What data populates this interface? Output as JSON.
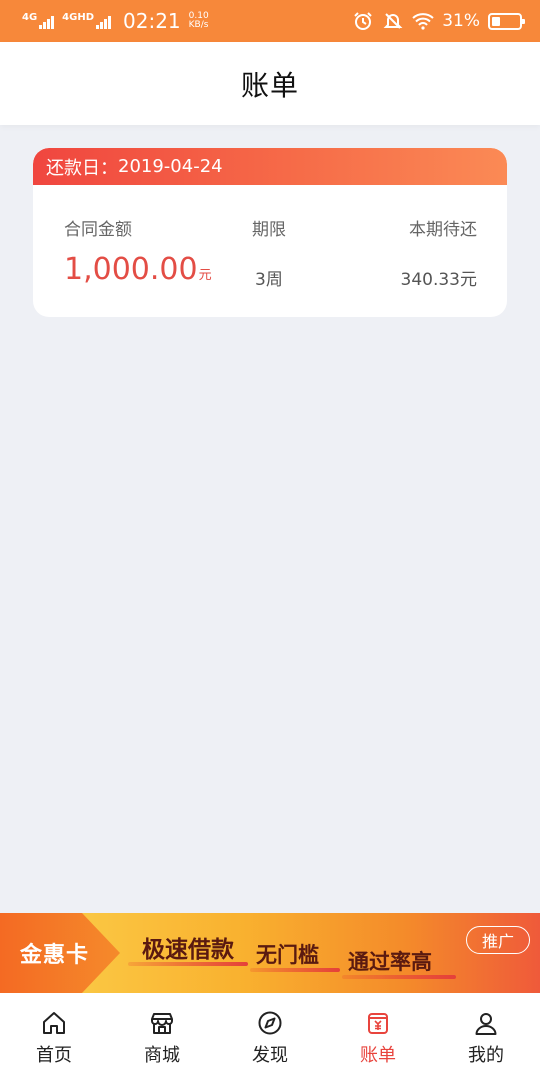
{
  "status_bar": {
    "net1": "4G",
    "net2": "4GHD",
    "time": "02:21",
    "speed_value": "0.10",
    "speed_unit": "KB/s",
    "battery_pct": "31%",
    "battery_level": 0.31,
    "icons": [
      "alarm-icon",
      "mute-bell-icon",
      "wifi-icon",
      "battery-icon"
    ]
  },
  "header": {
    "title": "账单"
  },
  "bill": {
    "due_label": "还款日：",
    "due_date": "2019-04-24",
    "contract_label": "合同金额",
    "contract_amount": "1,000.00",
    "contract_unit": "元",
    "term_label": "期限",
    "term_value": "3周",
    "current_label": "本期待还",
    "current_value": "340.33元"
  },
  "promo": {
    "brand": "金惠卡",
    "slogan1": "极速借款",
    "slogan2": "无门槛",
    "slogan3": "通过率高",
    "ad_label": "推广"
  },
  "nav": {
    "items": [
      {
        "label": "首页",
        "icon": "home-icon",
        "active": false
      },
      {
        "label": "商城",
        "icon": "shop-icon",
        "active": false
      },
      {
        "label": "发现",
        "icon": "compass-icon",
        "active": false
      },
      {
        "label": "账单",
        "icon": "bill-icon",
        "active": true
      },
      {
        "label": "我的",
        "icon": "user-icon",
        "active": false
      }
    ]
  },
  "colors": {
    "status_bar": "#f7883a",
    "accent_red": "#e8443d",
    "amount": "#e34d45",
    "background": "#eef0f5"
  }
}
